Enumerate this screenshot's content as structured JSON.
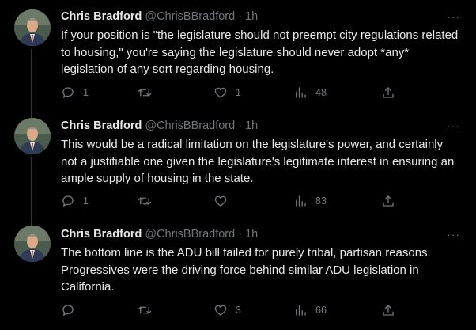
{
  "tweets": [
    {
      "name": "Chris Bradford",
      "handle": "@ChrisBBradford",
      "separator": "·",
      "time": "1h",
      "more": "···",
      "text": "If your position is \"the legislature should not preempt city regulations related to housing,\" you're saying the legislature should never adopt *any* legislation of any sort regarding housing.",
      "replies": "1",
      "retweets": "",
      "likes": "1",
      "views": "48"
    },
    {
      "name": "Chris Bradford",
      "handle": "@ChrisBBradford",
      "separator": "·",
      "time": "1h",
      "more": "···",
      "text": "This would be a radical limitation on the legislature's power, and certainly not a justifiable one given the legislature's  legitimate interest in ensuring an ample supply of housing in the state.",
      "replies": "1",
      "retweets": "",
      "likes": "",
      "views": "83"
    },
    {
      "name": "Chris Bradford",
      "handle": "@ChrisBBradford",
      "separator": "·",
      "time": "1h",
      "more": "···",
      "text": "The bottom line is the ADU bill failed for purely tribal, partisan reasons. Progressives were the driving force behind similar ADU legislation in California.",
      "replies": "",
      "retweets": "",
      "likes": "3",
      "views": "66"
    }
  ],
  "icons": {
    "reply": "reply-icon",
    "retweet": "retweet-icon",
    "like": "heart-icon",
    "views": "views-icon",
    "share": "share-icon"
  },
  "colors": {
    "background": "#000000",
    "text": "#e7e9ea",
    "muted": "#71767b",
    "thread_line": "#333639"
  }
}
